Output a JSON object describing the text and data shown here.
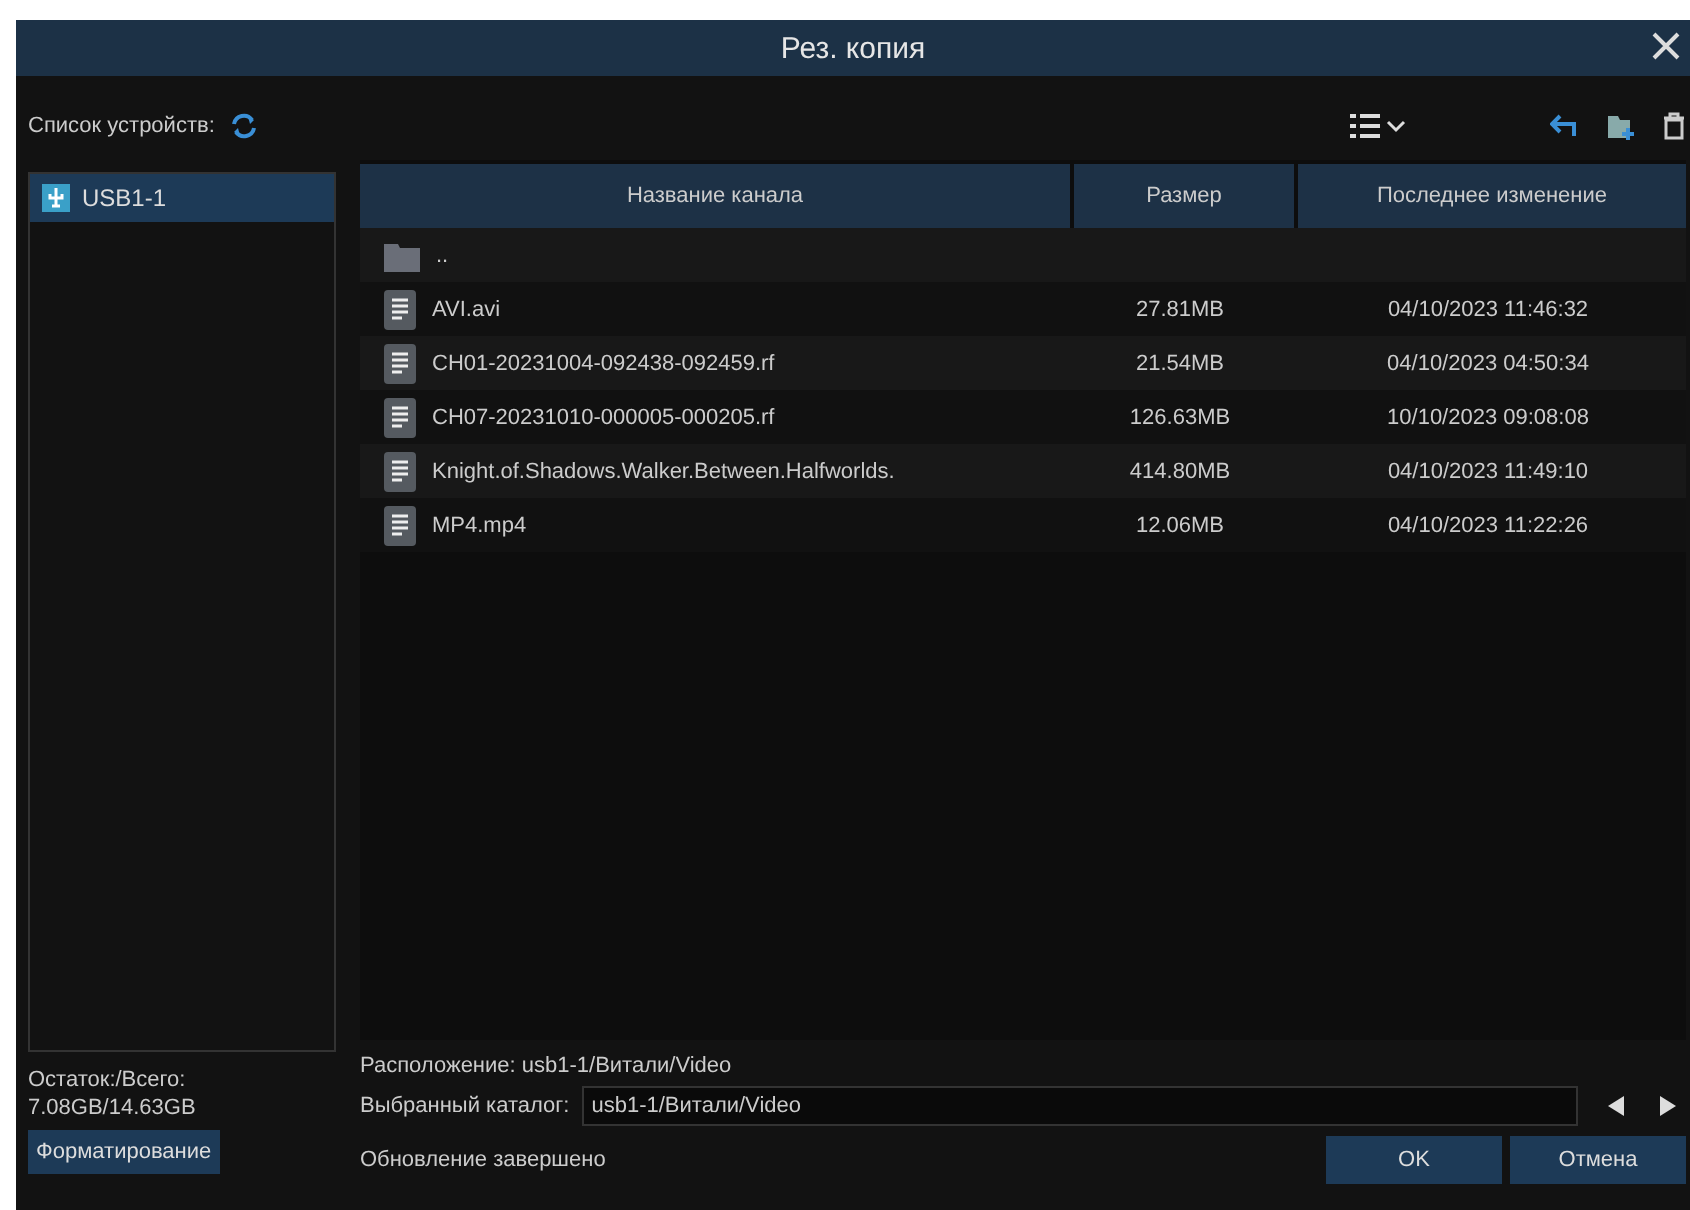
{
  "window": {
    "title": "Рез. копия"
  },
  "devices": {
    "label": "Список устройств:",
    "items": [
      {
        "name": "USB1-1",
        "selected": true
      }
    ]
  },
  "storage": {
    "label": "Остаток:/Всего:",
    "value": "7.08GB/14.63GB"
  },
  "format_button": "Форматирование",
  "table": {
    "columns": [
      "Название канала",
      "Размер",
      "Последнее изменение"
    ],
    "rows": [
      {
        "kind": "folder",
        "name": "..",
        "size": "",
        "modified": ""
      },
      {
        "kind": "file",
        "name": "AVI.avi",
        "size": "27.81MB",
        "modified": "04/10/2023 11:46:32"
      },
      {
        "kind": "file",
        "name": "CH01-20231004-092438-092459.rf",
        "size": "21.54MB",
        "modified": "04/10/2023 04:50:34"
      },
      {
        "kind": "file",
        "name": "CH07-20231010-000005-000205.rf",
        "size": "126.63MB",
        "modified": "10/10/2023 09:08:08"
      },
      {
        "kind": "file",
        "name": "Knight.of.Shadows.Walker.Between.Halfworlds.",
        "size": "414.80MB",
        "modified": "04/10/2023 11:49:10"
      },
      {
        "kind": "file",
        "name": "MP4.mp4",
        "size": "12.06MB",
        "modified": "04/10/2023 11:22:26"
      }
    ]
  },
  "location": "Расположение: usb1-1/Витали/Video",
  "selected_dir": {
    "label": "Выбранный каталог:",
    "value": "usb1-1/Витали/Video"
  },
  "status": "Обновление завершено",
  "buttons": [
    "OK",
    "Отмена"
  ]
}
